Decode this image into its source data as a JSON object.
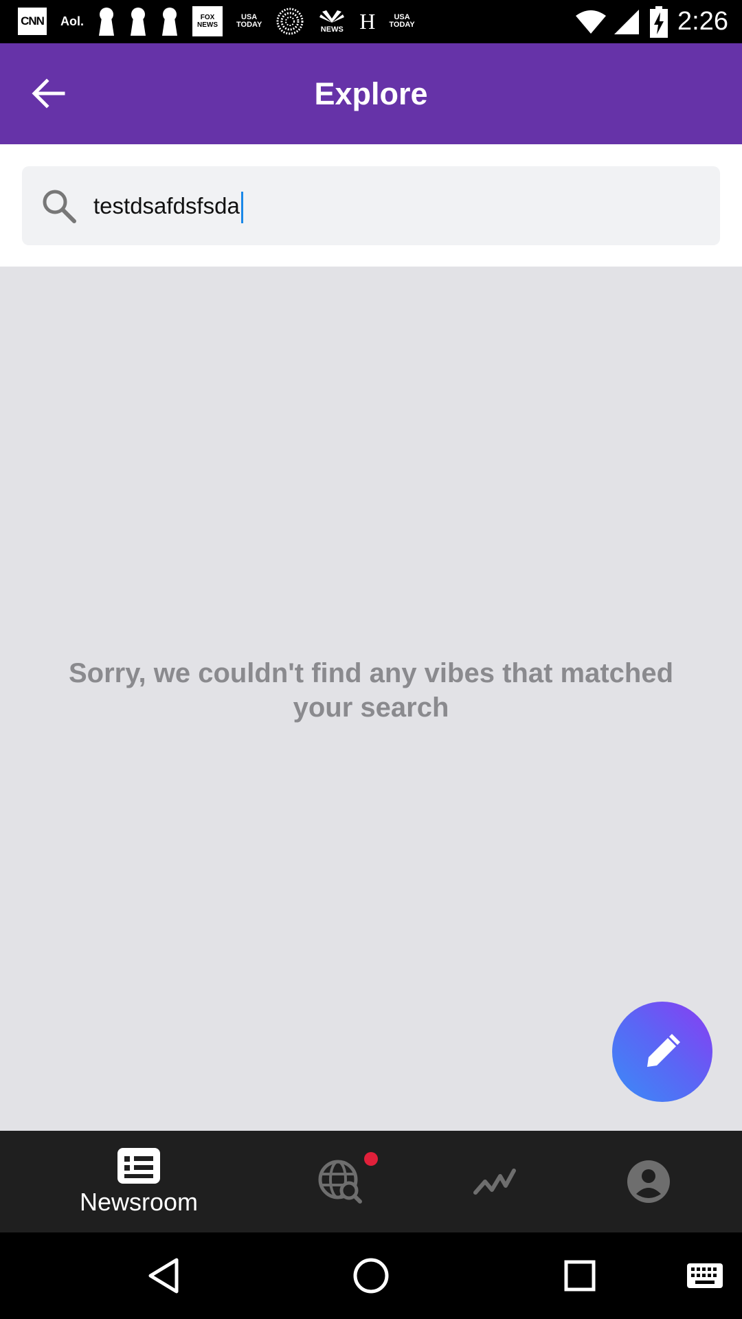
{
  "status_bar": {
    "time": "2:26",
    "notification_icons": {
      "cnn": "CNN",
      "aol": "Aol.",
      "fox_top": "FOX",
      "fox_bottom": "NEWS",
      "usa1_top": "USA",
      "usa1_bottom": "TODAY",
      "nbc": "NEWS",
      "h": "H",
      "usa2_top": "USA",
      "usa2_bottom": "TODAY"
    },
    "icons": [
      "wifi-icon",
      "cellular-signal-icon",
      "battery-charging-icon"
    ]
  },
  "app_bar": {
    "title": "Explore",
    "back_icon": "arrow-left-icon"
  },
  "search": {
    "value": "testdsafdsfsda",
    "icon": "search-icon"
  },
  "content": {
    "empty_message": "Sorry, we couldn't find any vibes that matched your search"
  },
  "fab": {
    "icon": "pencil-icon"
  },
  "bottom_nav": {
    "items": [
      {
        "label": "Newsroom",
        "icon": "newsroom-icon",
        "active": true
      },
      {
        "label": "",
        "icon": "globe-search-icon",
        "badge": true
      },
      {
        "label": "",
        "icon": "trending-icon"
      },
      {
        "label": "",
        "icon": "profile-icon"
      }
    ],
    "active_color": "#ffffff",
    "inactive_color": "#6e6e6e",
    "badge_color": "#e0203a"
  },
  "system_nav": [
    "back-triangle-icon",
    "home-circle-icon",
    "recents-square-icon",
    "keyboard-icon"
  ],
  "colors": {
    "app_bar": "#6633a8",
    "background": "#e2e2e6",
    "search_box": "#f1f2f4",
    "caret": "#1a88e8"
  }
}
